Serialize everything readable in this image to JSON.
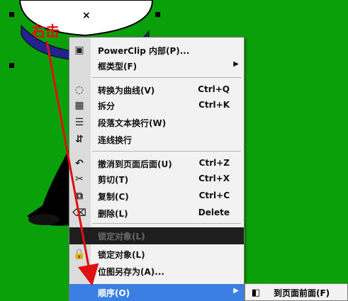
{
  "annotation": "右击",
  "menu": {
    "items": [
      {
        "label": "PowerClip 内部(P)...",
        "icon": "powerclip-icon",
        "shortcut": "",
        "submenu": false
      },
      {
        "label": "框类型(F)",
        "icon": "",
        "shortcut": "",
        "submenu": true
      },
      {
        "label": "转换为曲线(V)",
        "icon": "convert-curves-icon",
        "shortcut": "Ctrl+Q",
        "submenu": false
      },
      {
        "label": "拆分",
        "icon": "break-apart-icon",
        "shortcut": "Ctrl+K",
        "submenu": false
      },
      {
        "label": "段落文本换行(W)",
        "icon": "wrap-text-icon",
        "shortcut": "",
        "submenu": false
      },
      {
        "label": "连线换行",
        "icon": "wrap-line-icon",
        "shortcut": "",
        "submenu": false
      },
      {
        "label": "撤消到页面后面(U)",
        "icon": "undo-icon",
        "shortcut": "Ctrl+Z",
        "submenu": false
      },
      {
        "label": "剪切(T)",
        "icon": "cut-icon",
        "shortcut": "Ctrl+X",
        "submenu": false
      },
      {
        "label": "复制(C)",
        "icon": "copy-icon",
        "shortcut": "Ctrl+C",
        "submenu": false
      },
      {
        "label": "删除(L)",
        "icon": "delete-icon",
        "shortcut": "Delete",
        "submenu": false
      },
      {
        "label": "锁定对象(L)",
        "icon": "",
        "shortcut": "",
        "submenu": false,
        "state": "disabled"
      },
      {
        "label": "锁定对象(L)",
        "icon": "lock-icon",
        "shortcut": "",
        "submenu": false
      },
      {
        "label": "位图另存为(A)...",
        "icon": "",
        "shortcut": "",
        "submenu": false
      },
      {
        "label": "顺序(O)",
        "icon": "",
        "shortcut": "",
        "submenu": true,
        "state": "selected"
      }
    ]
  },
  "submenu": {
    "items": [
      {
        "label": "到页面前面(F)",
        "icon": "to-front-icon"
      }
    ]
  },
  "colors": {
    "background": "#0aa00a",
    "annotation": "#e01010",
    "highlight": "#3c7fe3",
    "disabled_row": "#1e1e1e"
  }
}
